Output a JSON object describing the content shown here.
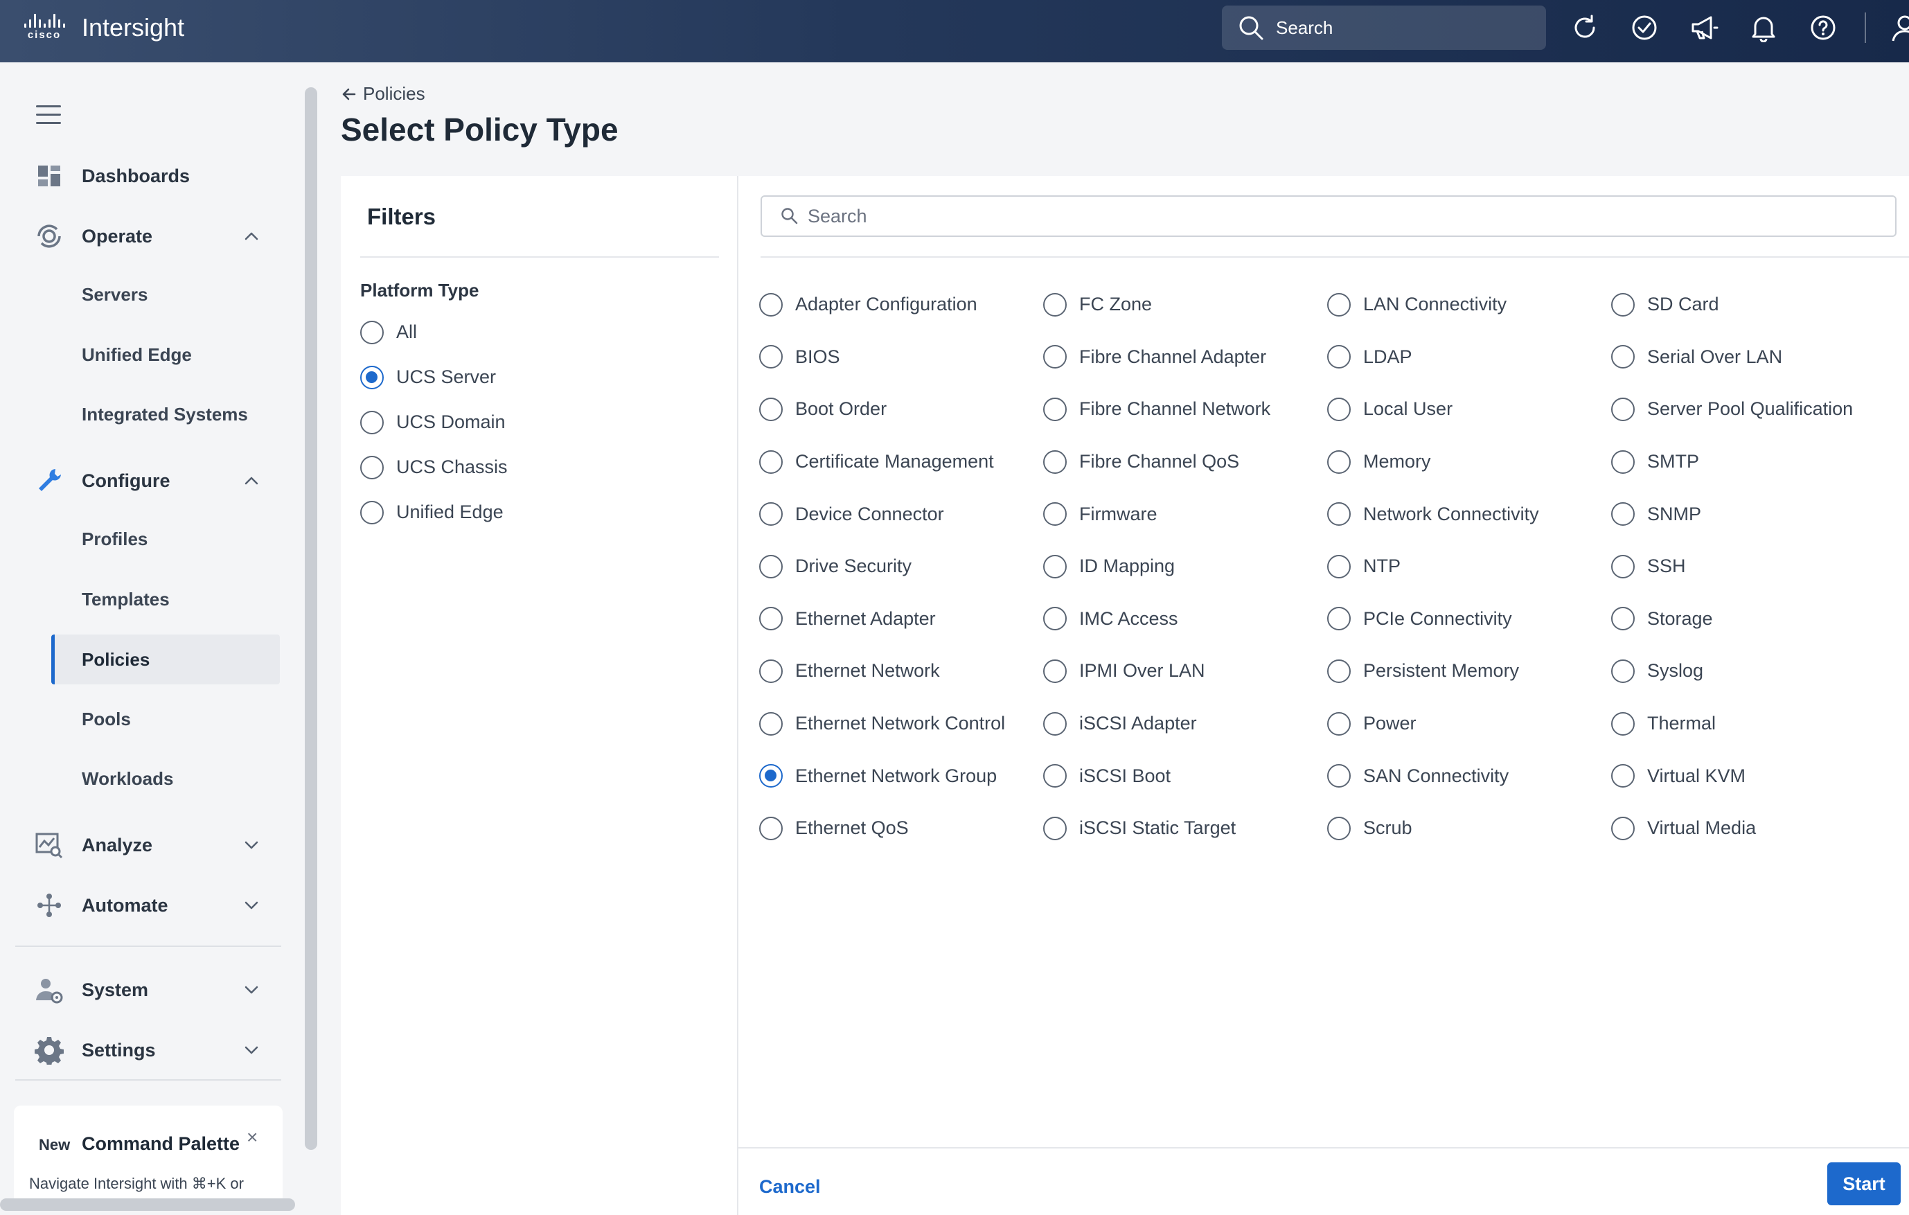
{
  "header": {
    "logo_text": "cisco",
    "app_title": "Intersight",
    "search_label": "Search"
  },
  "sidebar": {
    "dashboards": "Dashboards",
    "operate": "Operate",
    "operate_items": [
      "Servers",
      "Unified Edge",
      "Integrated Systems"
    ],
    "configure": "Configure",
    "configure_items": [
      "Profiles",
      "Templates",
      "Policies",
      "Pools",
      "Workloads"
    ],
    "active_item": "Policies",
    "analyze": "Analyze",
    "automate": "Automate",
    "system": "System",
    "settings": "Settings",
    "command_palette": {
      "badge": "New",
      "title": "Command Palette",
      "close": "×",
      "description": "Navigate Intersight with ⌘+K or"
    }
  },
  "breadcrumb": {
    "back_label": "Policies"
  },
  "page_title": "Select Policy Type",
  "filters": {
    "title": "Filters",
    "platform_type_label": "Platform Type",
    "options": [
      {
        "label": "All",
        "checked": false
      },
      {
        "label": "UCS Server",
        "checked": true
      },
      {
        "label": "UCS Domain",
        "checked": false
      },
      {
        "label": "UCS Chassis",
        "checked": false
      },
      {
        "label": "Unified Edge",
        "checked": false
      }
    ]
  },
  "policy_search": {
    "placeholder": "Search"
  },
  "policies": {
    "selected": "Ethernet Network Group",
    "items": [
      "Adapter Configuration",
      "FC Zone",
      "LAN Connectivity",
      "SD Card",
      "BIOS",
      "Fibre Channel Adapter",
      "LDAP",
      "Serial Over LAN",
      "Boot Order",
      "Fibre Channel Network",
      "Local User",
      "Server Pool Qualification",
      "Certificate Management",
      "Fibre Channel QoS",
      "Memory",
      "SMTP",
      "Device Connector",
      "Firmware",
      "Network Connectivity",
      "SNMP",
      "Drive Security",
      "ID Mapping",
      "NTP",
      "SSH",
      "Ethernet Adapter",
      "IMC Access",
      "PCIe Connectivity",
      "Storage",
      "Ethernet Network",
      "IPMI Over LAN",
      "Persistent Memory",
      "Syslog",
      "Ethernet Network Control",
      "iSCSI Adapter",
      "Power",
      "Thermal",
      "Ethernet Network Group",
      "iSCSI Boot",
      "SAN Connectivity",
      "Virtual KVM",
      "Ethernet QoS",
      "iSCSI Static Target",
      "Scrub",
      "Virtual Media"
    ]
  },
  "footer": {
    "cancel": "Cancel",
    "start": "Start"
  },
  "colors": {
    "accent": "#1d69cc",
    "header_dark": "#17294a"
  }
}
